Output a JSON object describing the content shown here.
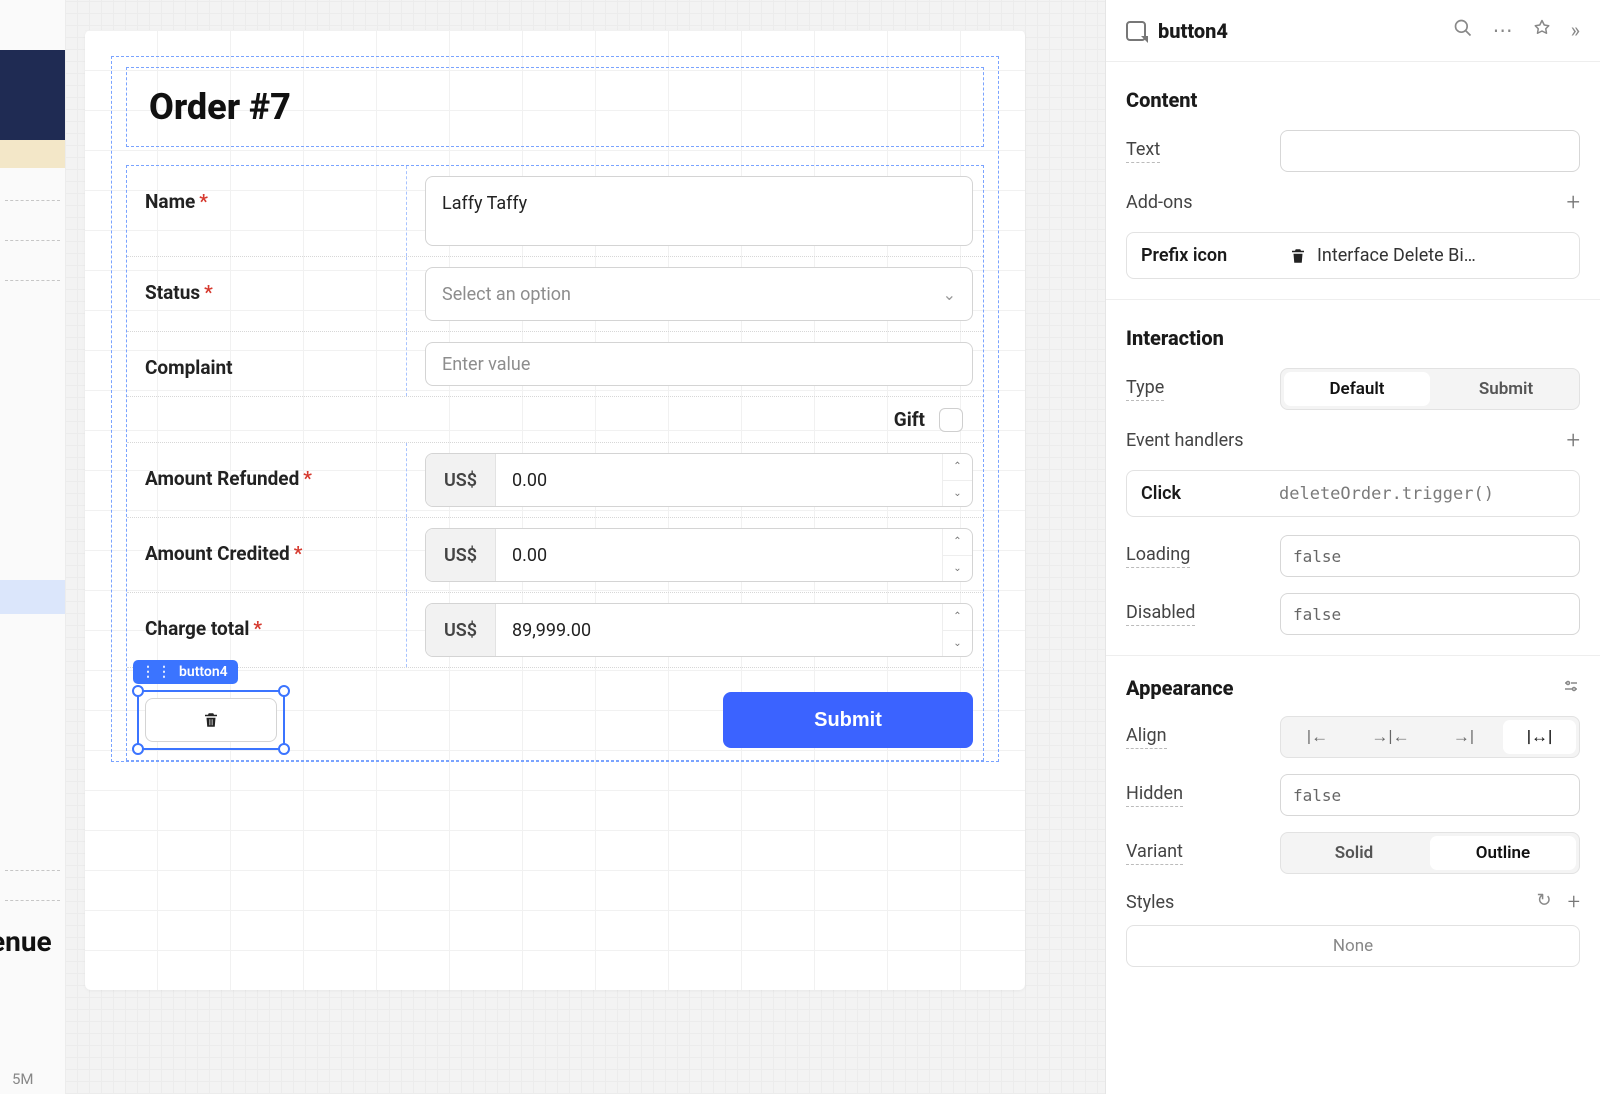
{
  "left_strip": {
    "text1": "enue",
    "text2": "5M"
  },
  "form": {
    "title": "Order #7",
    "name": {
      "label": "Name",
      "required": true,
      "value": "Laffy Taffy"
    },
    "status": {
      "label": "Status",
      "required": true,
      "placeholder": "Select an option"
    },
    "complaint": {
      "label": "Complaint",
      "required": false,
      "placeholder": "Enter value"
    },
    "gift": {
      "label": "Gift"
    },
    "amount_refunded": {
      "label": "Amount Refunded",
      "required": true,
      "prefix": "US$",
      "value": "0.00"
    },
    "amount_credited": {
      "label": "Amount Credited",
      "required": true,
      "prefix": "US$",
      "value": "0.00"
    },
    "charge_total": {
      "label": "Charge total",
      "required": true,
      "prefix": "US$",
      "value": "89,999.00"
    },
    "selection_tag": "button4",
    "submit_label": "Submit"
  },
  "inspector": {
    "component_name": "button4",
    "sections": {
      "content": {
        "title": "Content",
        "text_label": "Text",
        "text_value": "",
        "addons_label": "Add-ons",
        "addon": {
          "label": "Prefix icon",
          "value": "Interface Delete Bi…"
        }
      },
      "interaction": {
        "title": "Interaction",
        "type_label": "Type",
        "type_options": [
          "Default",
          "Submit"
        ],
        "type_active": "Default",
        "event_handlers_label": "Event handlers",
        "handler": {
          "event": "Click",
          "code": "deleteOrder.trigger()"
        },
        "loading_label": "Loading",
        "loading_value": "false",
        "disabled_label": "Disabled",
        "disabled_value": "false"
      },
      "appearance": {
        "title": "Appearance",
        "align_label": "Align",
        "hidden_label": "Hidden",
        "hidden_value": "false",
        "variant_label": "Variant",
        "variant_options": [
          "Solid",
          "Outline"
        ],
        "variant_active": "Outline",
        "styles_label": "Styles",
        "styles_none": "None"
      }
    }
  }
}
